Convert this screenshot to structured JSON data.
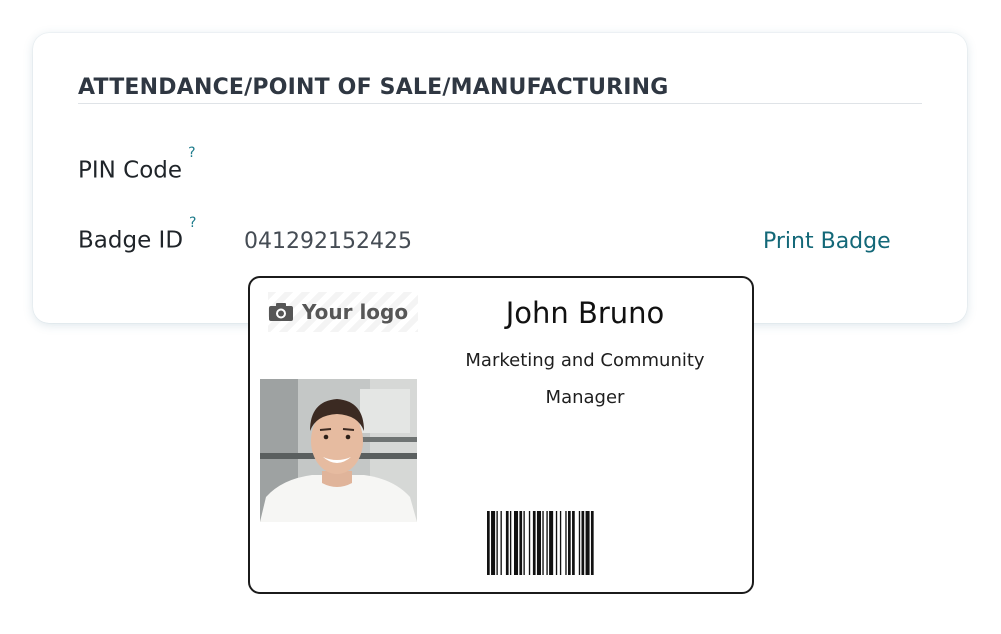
{
  "section": {
    "title": "ATTENDANCE/POINT OF SALE/MANUFACTURING"
  },
  "fields": {
    "pin": {
      "label": "PIN Code",
      "help": "?"
    },
    "badge": {
      "label": "Badge ID",
      "help": "?",
      "value": "041292152425"
    },
    "print_badge": "Print Badge"
  },
  "badge_card": {
    "logo_text": "Your logo",
    "name": "John Bruno",
    "role_line1": "Marketing and Community",
    "role_line2": "Manager",
    "photo_icon": "employee-photo",
    "barcode_icon": "barcode"
  },
  "colors": {
    "accent": "#136878",
    "help": "#1f7c8c",
    "text": "#1f2429",
    "title": "#2f3742"
  }
}
